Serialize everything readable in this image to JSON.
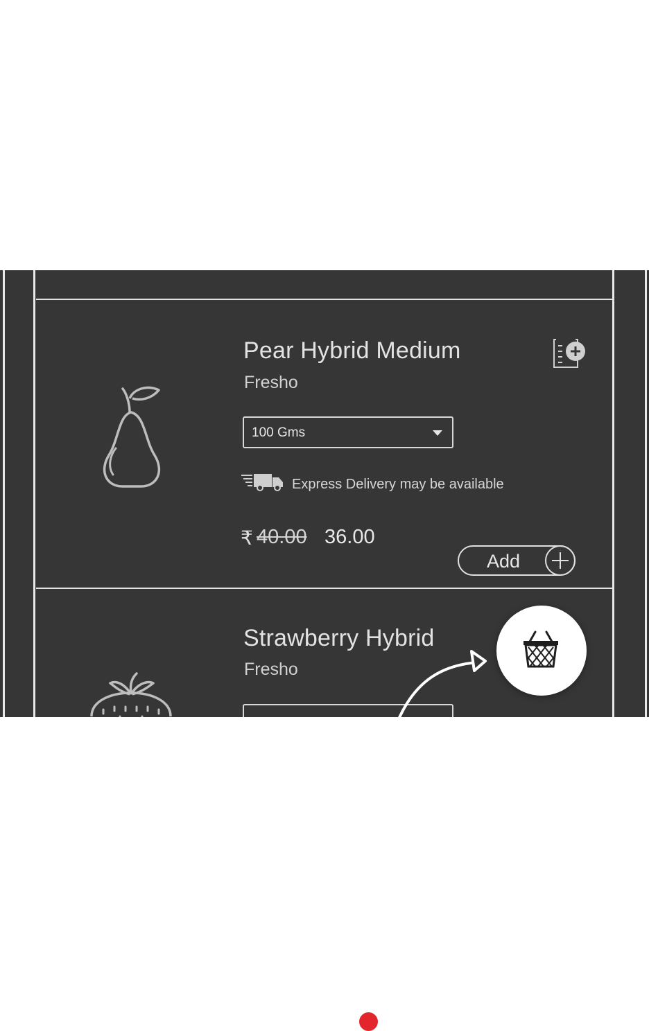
{
  "products": [
    {
      "name": "Pear Hybrid Medium",
      "brand": "Fresho",
      "quantity": "100 Gms",
      "delivery_note": "Express Delivery may be available",
      "currency": "₹",
      "mrp": "40.00",
      "price": "36.00",
      "add_label": "Add",
      "image_icon": "pear-icon"
    },
    {
      "name": "Strawberry Hybrid",
      "brand": "Fresho",
      "image_icon": "strawberry-icon"
    }
  ],
  "basket": {
    "icon": "basket-icon"
  },
  "colors": {
    "panel": "#363636",
    "accent_dot": "#e3262c"
  }
}
